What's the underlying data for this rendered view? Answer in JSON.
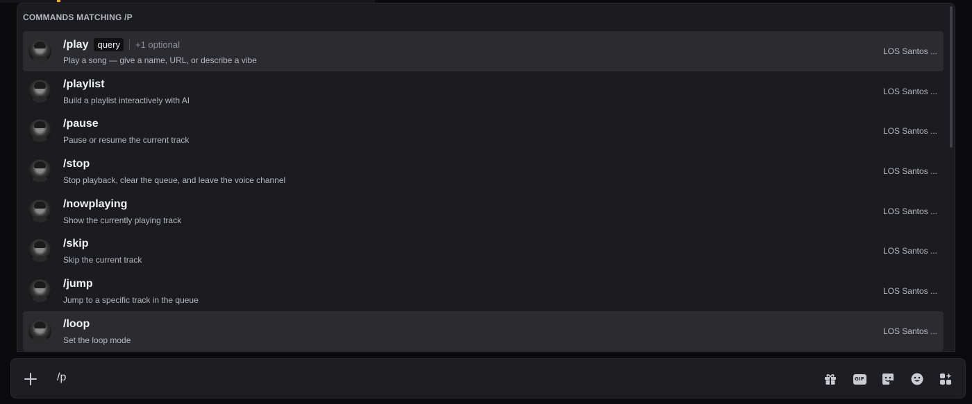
{
  "popup": {
    "header": "COMMANDS MATCHING /P",
    "commands": [
      {
        "name": "/play",
        "param": "query",
        "optional": "+1 optional",
        "description": "Play a song — give a name, URL, or describe a vibe",
        "source": "LOS Santos ..."
      },
      {
        "name": "/playlist",
        "description": "Build a playlist interactively with AI",
        "source": "LOS Santos ..."
      },
      {
        "name": "/pause",
        "description": "Pause or resume the current track",
        "source": "LOS Santos ..."
      },
      {
        "name": "/stop",
        "description": "Stop playback, clear the queue, and leave the voice channel",
        "source": "LOS Santos ..."
      },
      {
        "name": "/nowplaying",
        "description": "Show the currently playing track",
        "source": "LOS Santos ..."
      },
      {
        "name": "/skip",
        "description": "Skip the current track",
        "source": "LOS Santos ..."
      },
      {
        "name": "/jump",
        "description": "Jump to a specific track in the queue",
        "source": "LOS Santos ..."
      },
      {
        "name": "/loop",
        "description": "Set the loop mode",
        "source": "LOS Santos ..."
      }
    ]
  },
  "composer": {
    "value": "/p",
    "add_icon": "plus-icon",
    "gif_label": "GIF",
    "tools": [
      "gift-icon",
      "gif-icon",
      "sticker-icon",
      "emoji-icon",
      "apps-icon"
    ]
  },
  "colors": {
    "background": "#0b0b0d",
    "popup": "#1c1c20",
    "row_active": "#2b2b30",
    "accent": "#f0b232"
  }
}
